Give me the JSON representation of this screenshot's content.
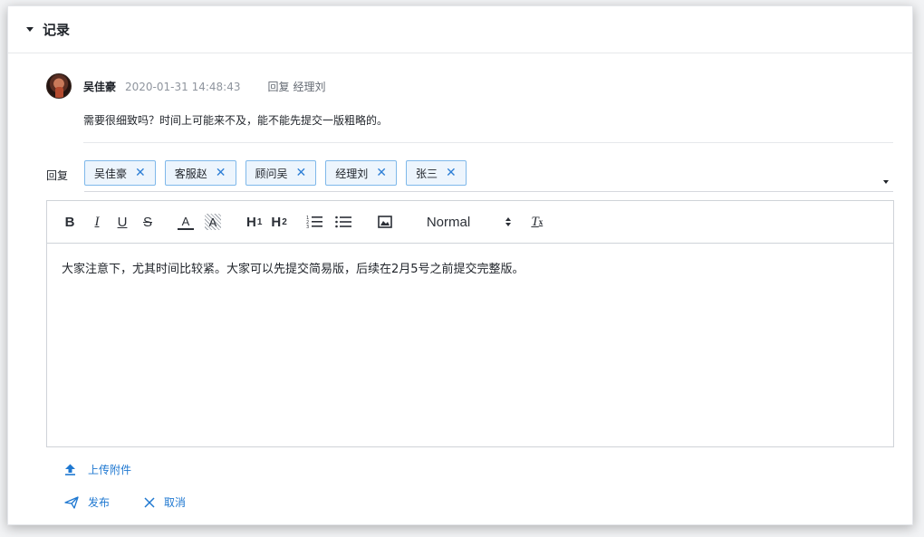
{
  "section": {
    "title": "记录"
  },
  "comment": {
    "author": "吴佳豪",
    "timestamp": "2020-01-31 14:48:43",
    "reply_word": "回复",
    "reply_to": "经理刘",
    "body": "需要很细致吗？时间上可能来不及，能不能先提交一版粗略的。"
  },
  "reply": {
    "label": "回复",
    "recipients": [
      "吴佳豪",
      "客服赵",
      "顾问吴",
      "经理刘",
      "张三"
    ],
    "close_glyph": "✕"
  },
  "editor": {
    "toolbar": {
      "bold": "B",
      "italic": "I",
      "underline": "U",
      "strike": "S",
      "color": "A",
      "background": "A",
      "h1": "H",
      "h1_sub": "1",
      "h2": "H",
      "h2_sub": "2",
      "size": "Normal",
      "clear": "T",
      "clear_sub": "x"
    },
    "content": "大家注意下，尤其时间比较紧。大家可以先提交简易版，后续在2月5号之前提交完整版。"
  },
  "upload": {
    "label": "上传附件"
  },
  "actions": {
    "publish": "发布",
    "cancel": "取消"
  },
  "colors": {
    "accent": "#1f78d1",
    "tag_border": "#7fb8ea",
    "tag_bg": "#edf5fd"
  }
}
